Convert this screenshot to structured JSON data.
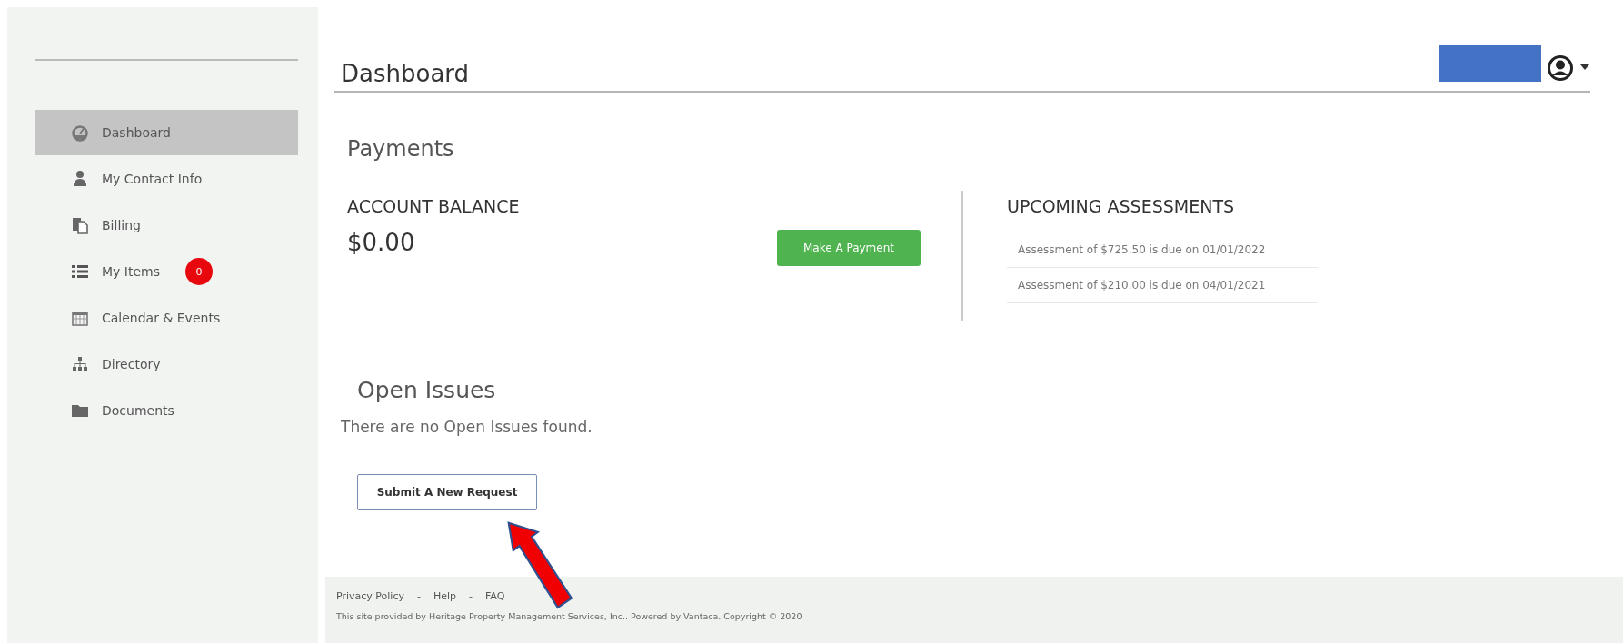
{
  "sidebar": {
    "items": [
      {
        "label": "Dashboard",
        "selected": true
      },
      {
        "label": "My Contact Info",
        "selected": false
      },
      {
        "label": "Billing",
        "selected": false
      },
      {
        "label": "My Items",
        "selected": false,
        "badge": "0"
      },
      {
        "label": "Calendar & Events",
        "selected": false
      },
      {
        "label": "Directory",
        "selected": false
      },
      {
        "label": "Documents",
        "selected": false
      }
    ]
  },
  "header": {
    "title": "Dashboard"
  },
  "payments": {
    "title": "Payments",
    "balance_label": "ACCOUNT BALANCE",
    "balance": "$0.00",
    "pay_button": "Make A Payment",
    "assessments_title": "UPCOMING ASSESSMENTS",
    "assessments": [
      "Assessment of $725.50 is due on 01/01/2022",
      "Assessment of $210.00 is due on 04/01/2021"
    ]
  },
  "open_issues": {
    "title": "Open Issues",
    "message": "There are no Open Issues found.",
    "button": "Submit A New Request"
  },
  "footer": {
    "links": [
      "Privacy Policy",
      "Help",
      "FAQ"
    ],
    "separator": "-",
    "text": "This site provided by Heritage Property Management Services, Inc.. Powered by Vantaca. Copyright © 2020"
  }
}
